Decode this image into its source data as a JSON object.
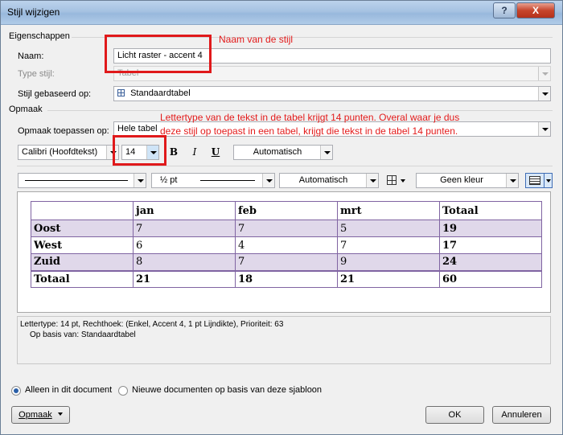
{
  "window": {
    "title": "Stijl wijzigen",
    "help": "?",
    "close": "X"
  },
  "eigenschappen": {
    "section": "Eigenschappen",
    "naam_label": "Naam:",
    "naam_value": "Licht raster - accent 4",
    "type_label": "Type stijl:",
    "type_value": "Tabel",
    "basis_label": "Stijl gebaseerd op:",
    "basis_value": "Standaardtabel"
  },
  "opmaak": {
    "section": "Opmaak",
    "toepassen_label": "Opmaak toepassen op:",
    "toepassen_value": "Hele tabel",
    "font": "Calibri (Hoofdtekst)",
    "size": "14",
    "bold": "B",
    "italic": "I",
    "underline": "U",
    "font_color": "Automatisch",
    "line_weight": "½ pt",
    "line_color": "Automatisch",
    "shading": "Geen kleur"
  },
  "annotations": {
    "naam": "Naam van de stijl",
    "size_line1": "Lettertype van de tekst in de tabel krijgt 14 punten. Overal waar je dus",
    "size_line2": "deze stijl op toepast in een tabel, krijgt die tekst in de tabel 14 punten."
  },
  "preview_table": {
    "header": [
      "",
      "jan",
      "feb",
      "mrt",
      "Totaal"
    ],
    "rows": [
      [
        "Oost",
        "7",
        "7",
        "5",
        "19"
      ],
      [
        "West",
        "6",
        "4",
        "7",
        "17"
      ],
      [
        "Zuid",
        "8",
        "7",
        "9",
        "24"
      ],
      [
        "Totaal",
        "21",
        "18",
        "21",
        "60"
      ]
    ]
  },
  "description": {
    "line1": "Lettertype: 14 pt, Rechthoek: (Enkel, Accent 4,  1 pt Lijndikte), Prioriteit: 63",
    "line2": "Op basis van: Standaardtabel"
  },
  "options": {
    "radio1": "Alleen in dit document",
    "radio2": "Nieuwe documenten op basis van deze sjabloon",
    "radio1_selected": true
  },
  "buttons": {
    "opmaak": "Opmaak",
    "ok": "OK",
    "cancel": "Annuleren"
  },
  "colors": {
    "accent": "#8064a2",
    "band": "#e0d8ea",
    "annotation": "#e31b1b"
  }
}
